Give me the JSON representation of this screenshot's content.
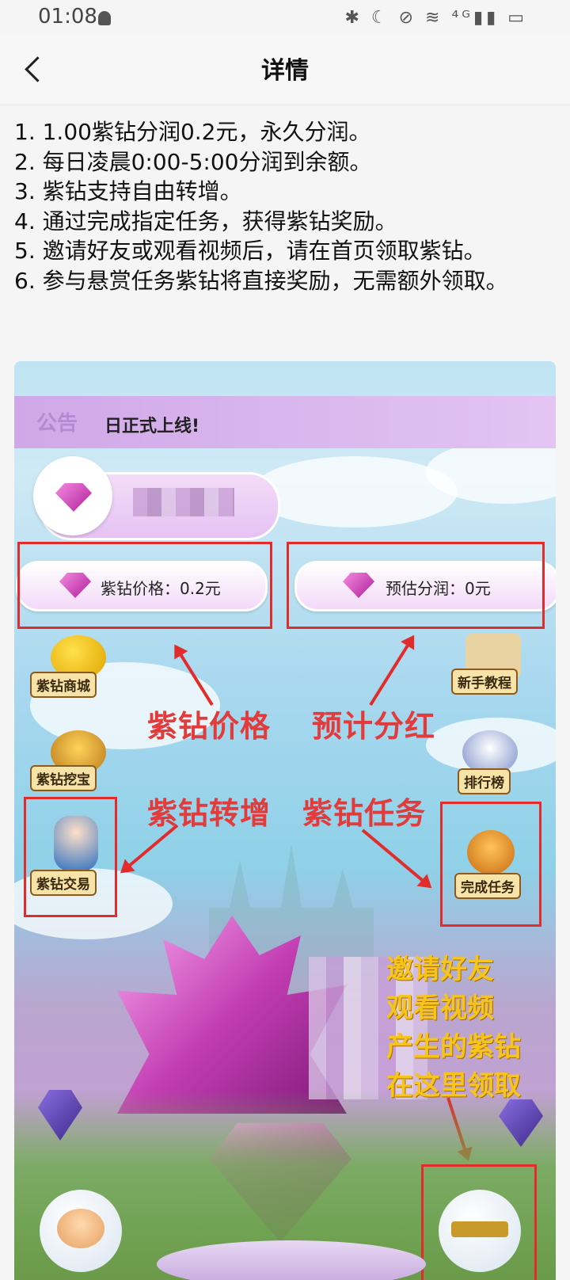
{
  "status_bar": {
    "time": "01:08",
    "icons_text": "✱ ☾ ⊘ ≋ ⁴ᴳ▮▮ ▭"
  },
  "header": {
    "title": "详情",
    "back_icon": "chevron-left-icon"
  },
  "rules": [
    "1. 1.00紫钻分润0.2元，永久分润。",
    "2. 每日凌晨0:00-5:00分润到余额。",
    "3. 紫钻支持自由转增。",
    "4. 通过完成指定任务，获得紫钻奖励。",
    "5. 邀请好友或观看视频后，请在首页领取紫钻。",
    "6. 参与悬赏任务紫钻将直接奖励，无需额外领取。"
  ],
  "game": {
    "notice_tag": "公告",
    "notice_text": "日正式上线!",
    "price_pill": "紫钻价格：0.2元",
    "profit_pill": "预估分润：0元",
    "buttons": {
      "shop": "紫钻商城",
      "tutorial": "新手教程",
      "treasure": "紫钻挖宝",
      "ranking": "排行榜",
      "trade": "紫钻交易",
      "task": "完成任务"
    },
    "annotations": {
      "price": "紫钻价格",
      "dividend": "预计分红",
      "transfer": "紫钻转增",
      "task": "紫钻任务",
      "collect": [
        "邀请好友",
        "观看视频",
        "产生的紫钻",
        "在这里领取"
      ]
    },
    "colors": {
      "annotation_red": "#e22b2b",
      "annotation_gold": "#f6c41a",
      "gem_purple": "#b01e9a"
    }
  }
}
